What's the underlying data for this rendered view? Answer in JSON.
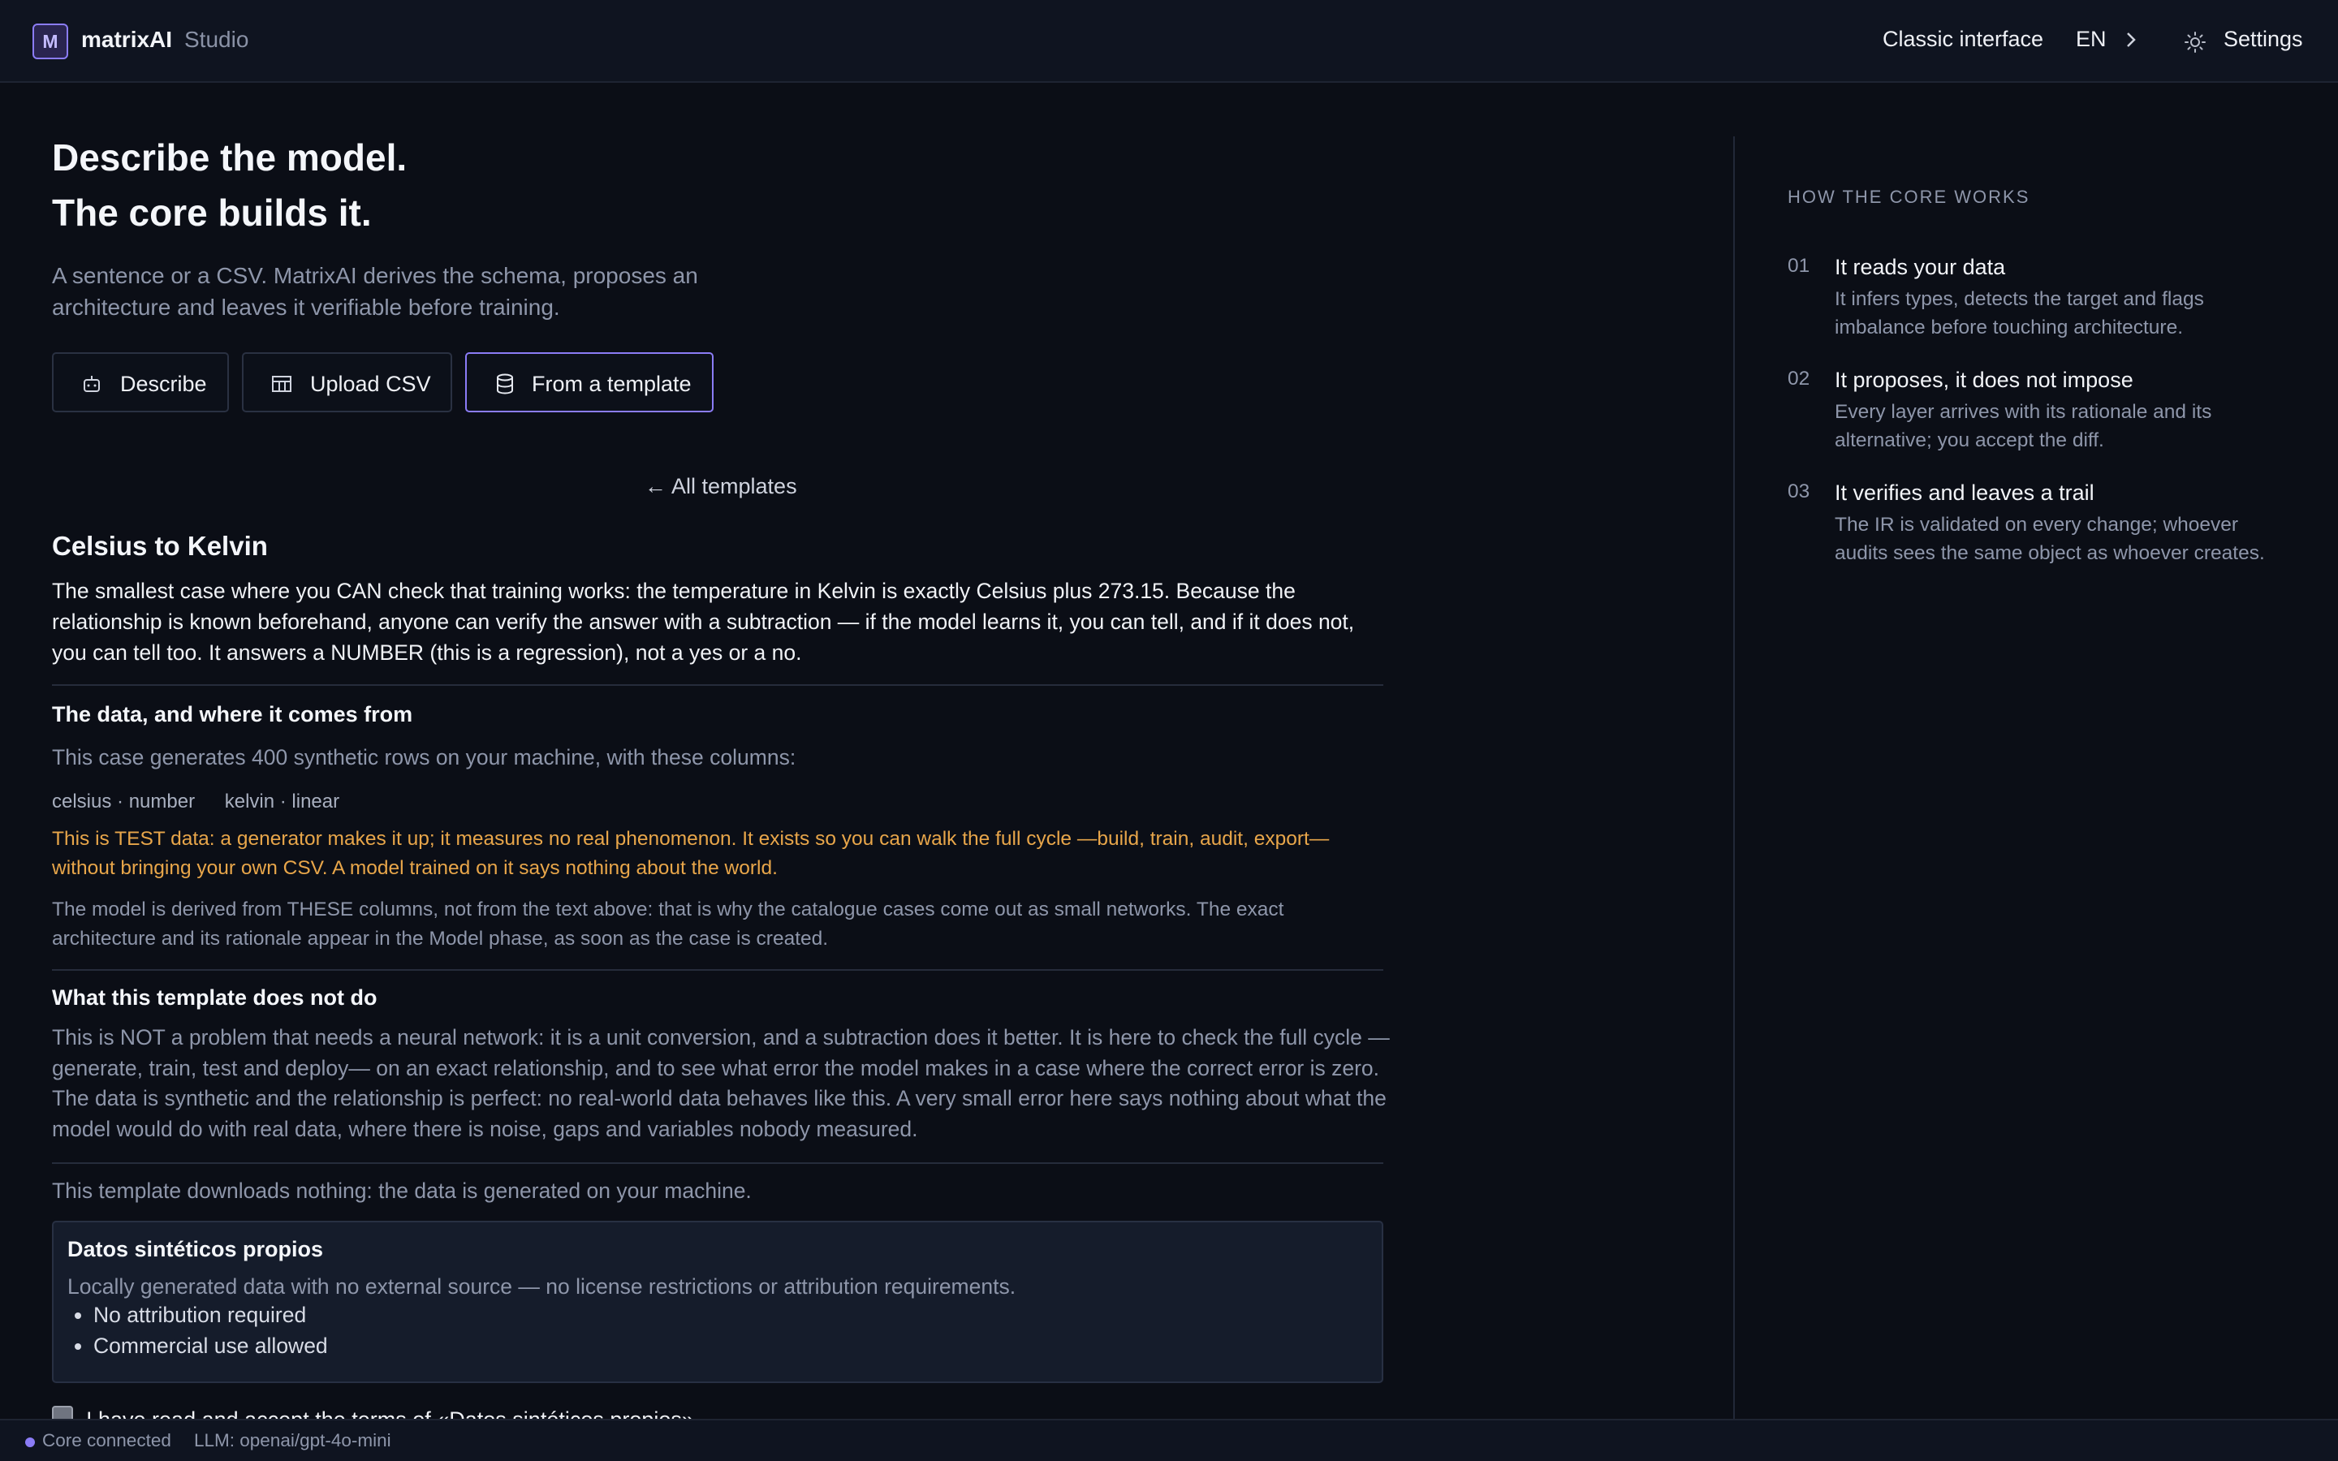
{
  "header": {
    "logo_letter": "M",
    "brand": "matrixAI",
    "brand_suffix": "Studio",
    "classic_interface": "Classic interface",
    "language": "EN",
    "settings": "Settings"
  },
  "hero": {
    "title_line1": "Describe the model.",
    "title_line2": "The core builds it.",
    "lead": "A sentence or a CSV. MatrixAI derives the schema, proposes an architecture and leaves it verifiable before training."
  },
  "tabs": [
    {
      "label": "Describe",
      "icon": "robot-icon",
      "active": false
    },
    {
      "label": "Upload CSV",
      "icon": "table-icon",
      "active": false
    },
    {
      "label": "From a template",
      "icon": "database-icon",
      "active": true
    }
  ],
  "template": {
    "back_link": "← All templates",
    "title": "Celsius to Kelvin",
    "description": "The smallest case where you CAN check that training works: the temperature in Kelvin is exactly Celsius plus 273.15. Because the relationship is known beforehand, anyone can verify the answer with a subtraction — if the model learns it, you can tell, and if it does not, you can tell too. It answers a NUMBER (this is a regression), not a yes or a no.",
    "data_heading": "The data, and where it comes from",
    "data_intro": "This case generates 400 synthetic rows on your machine, with these columns:",
    "columns": [
      "celsius · number",
      "kelvin · linear"
    ],
    "test_warning": "This is TEST data: a generator makes it up; it measures no real phenomenon. It exists so you can walk the full cycle —build, train, audit, export— without bringing your own CSV. A model trained on it says nothing about the world.",
    "derived_note": "The model is derived from THESE columns, not from the text above: that is why the catalogue cases come out as small networks. The exact architecture and its rationale appear in the Model phase, as soon as the case is created.",
    "not_do_heading": "What this template does not do",
    "not_do_text": "This is NOT a problem that needs a neural network: it is a unit conversion, and a subtraction does it better. It is here to check the full cycle —generate, train, test and deploy— on an exact relationship, and to see what error the model makes in a case where the correct error is zero. The data is synthetic and the relationship is perfect: no real-world data behaves like this. A very small error here says nothing about what the model would do with real data, where there is noise, gaps and variables nobody measured.",
    "download_note": "This template downloads nothing: the data is generated on your machine.",
    "license": {
      "title": "Datos sintéticos propios",
      "description": "Locally generated data with no external source — no license restrictions or attribution requirements.",
      "items": [
        "No attribution required",
        "Commercial use allowed"
      ]
    },
    "accept_label": "I have read and accept the terms of «Datos sintéticos propios».",
    "accept_checked": false
  },
  "sidebar": {
    "heading": "HOW THE CORE WORKS",
    "steps": [
      {
        "num": "01",
        "title": "It reads your data",
        "body": "It infers types, detects the target and flags imbalance before touching architecture."
      },
      {
        "num": "02",
        "title": "It proposes, it does not impose",
        "body": "Every layer arrives with its rationale and its alternative; you accept the diff."
      },
      {
        "num": "03",
        "title": "It verifies and leaves a trail",
        "body": "The IR is validated on every change; whoever audits sees the same object as whoever creates."
      }
    ]
  },
  "status": {
    "core": "Core connected",
    "llm": "LLM: openai/gpt-4o-mini",
    "accent": "#8b7cf6"
  }
}
